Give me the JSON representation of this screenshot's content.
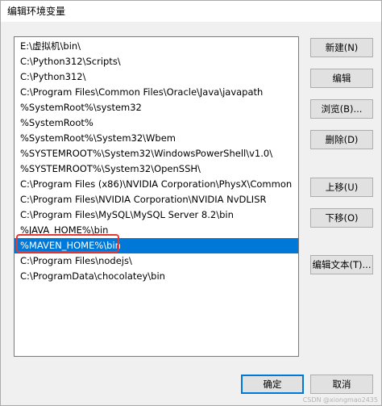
{
  "window": {
    "title": "编辑环境变量"
  },
  "path_list": {
    "items": [
      "E:\\虚拟机\\bin\\",
      "C:\\Python312\\Scripts\\",
      "C:\\Python312\\",
      "C:\\Program Files\\Common Files\\Oracle\\Java\\javapath",
      "%SystemRoot%\\system32",
      "%SystemRoot%",
      "%SystemRoot%\\System32\\Wbem",
      "%SYSTEMROOT%\\System32\\WindowsPowerShell\\v1.0\\",
      "%SYSTEMROOT%\\System32\\OpenSSH\\",
      "C:\\Program Files (x86)\\NVIDIA Corporation\\PhysX\\Common",
      "C:\\Program Files\\NVIDIA Corporation\\NVIDIA NvDLISR",
      "C:\\Program Files\\MySQL\\MySQL Server 8.2\\bin",
      "%JAVA_HOME%\\bin",
      "%MAVEN_HOME%\\bin",
      "C:\\Program Files\\nodejs\\",
      "C:\\ProgramData\\chocolatey\\bin"
    ],
    "selected_index": 13
  },
  "buttons": {
    "new": "新建(N)",
    "edit": "编辑",
    "browse": "浏览(B)...",
    "delete": "删除(D)",
    "move_up": "上移(U)",
    "move_down": "下移(O)",
    "edit_text": "编辑文本(T)...",
    "ok": "确定",
    "cancel": "取消"
  },
  "watermark": "CSDN @xiongmao2435",
  "colors": {
    "selection": "#0078d7",
    "annotation_box": "#e53935"
  }
}
